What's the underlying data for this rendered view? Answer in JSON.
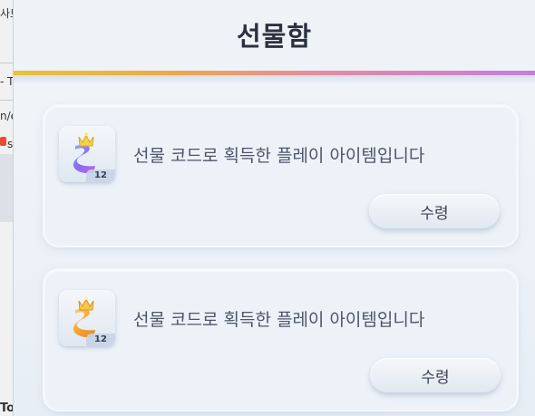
{
  "background_window": {
    "fragments": [
      "사트",
      "- T",
      "n/e",
      "s",
      "To"
    ]
  },
  "popup": {
    "title": "선물함",
    "accent_colors": [
      "#e9c23a",
      "#f0a848",
      "#e58aa4",
      "#c77de0"
    ]
  },
  "gifts": [
    {
      "icon": "blue-crowned-ribbon-icon",
      "quantity": "12",
      "description": "선물 코드로 획득한 플레이 아이템입니다",
      "claim_label": "수령"
    },
    {
      "icon": "gold-crowned-ribbon-icon",
      "quantity": "12",
      "description": "선물 코드로 획득한 플레이 아이템입니다",
      "claim_label": "수령"
    }
  ]
}
